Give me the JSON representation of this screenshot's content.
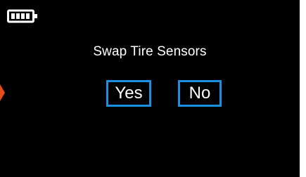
{
  "status_bar": {
    "battery_icon": "battery-full-icon"
  },
  "dialog": {
    "title": "Swap Tire Sensors",
    "yes_label": "Yes",
    "no_label": "No"
  },
  "colors": {
    "background": "#000000",
    "text": "#ffffff",
    "button_border": "#1b8fe0",
    "pointer": "#e64a19"
  },
  "selection_pointer_icon": "pointer-arrow-icon"
}
